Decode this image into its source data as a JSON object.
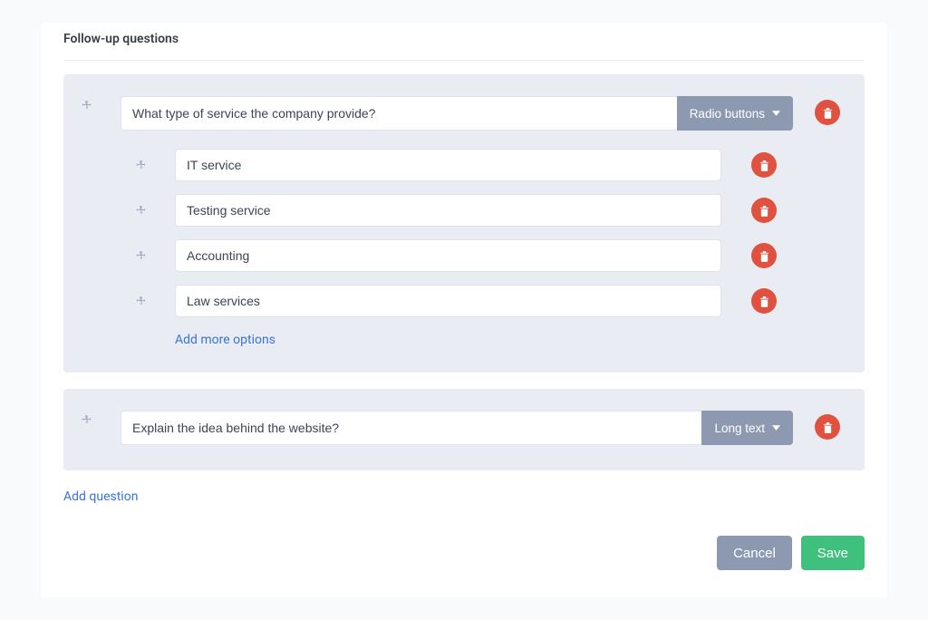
{
  "section_title": "Follow-up questions",
  "questions": [
    {
      "text": "What type of service the company provide?",
      "type_label": "Radio buttons",
      "options": [
        "IT service",
        "Testing service",
        "Accounting",
        "Law services"
      ],
      "add_more_label": "Add more options"
    },
    {
      "text": "Explain the idea behind the website?",
      "type_label": "Long text",
      "options": []
    }
  ],
  "add_question_label": "Add question",
  "buttons": {
    "cancel": "Cancel",
    "save": "Save"
  }
}
